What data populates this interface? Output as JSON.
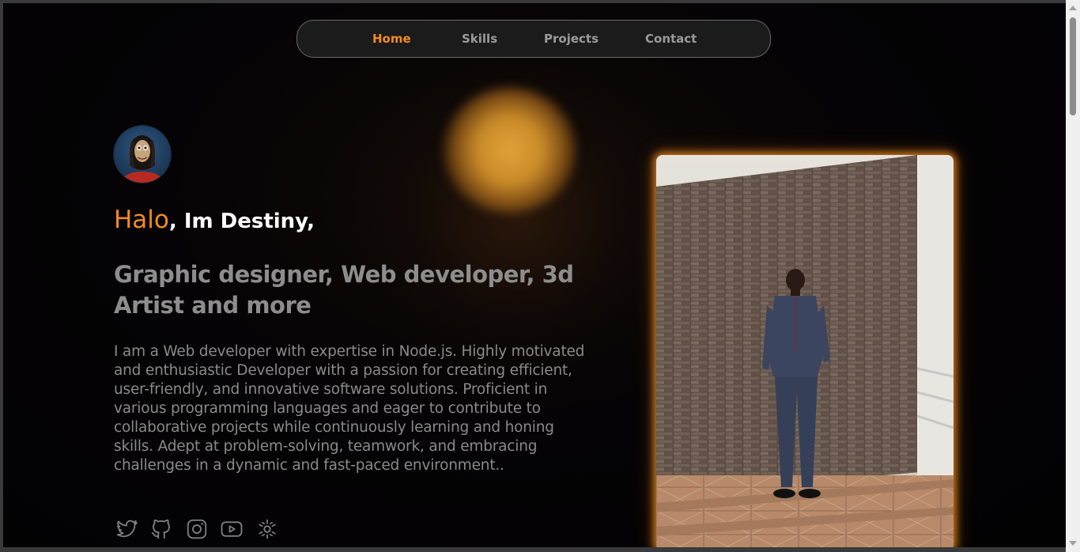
{
  "nav": {
    "items": [
      {
        "label": "Home",
        "active": true
      },
      {
        "label": "Skills",
        "active": false
      },
      {
        "label": "Projects",
        "active": false
      },
      {
        "label": "Contact",
        "active": false
      }
    ]
  },
  "hero": {
    "greeting_highlight": "Halo",
    "greeting_rest": ", Im Destiny,",
    "role": "Graphic designer, Web developer, 3d Artist and more",
    "bio": "I am a Web developer with expertise in Node.js. Highly motivated and enthusiastic Developer with a passion for creating efficient, user-friendly, and innovative software solutions. Proficient in various programming languages and eager to contribute to collaborative projects while continuously learning and honing skills. Adept at problem-solving, teamwork, and embracing challenges in a dynamic and fast-paced environment..",
    "avatar": "3d-character-avatar"
  },
  "socials": [
    {
      "icon": "twitter-icon"
    },
    {
      "icon": "github-icon"
    },
    {
      "icon": "instagram-icon"
    },
    {
      "icon": "youtube-icon"
    },
    {
      "icon": "figma-icon"
    }
  ],
  "colors": {
    "accent": "#f28a1f",
    "background": "#040306",
    "text_muted": "#8d8d8d",
    "nav_bg": "#1b1b1b"
  },
  "photo": {
    "subject": "man-standing-before-brick-wall"
  }
}
